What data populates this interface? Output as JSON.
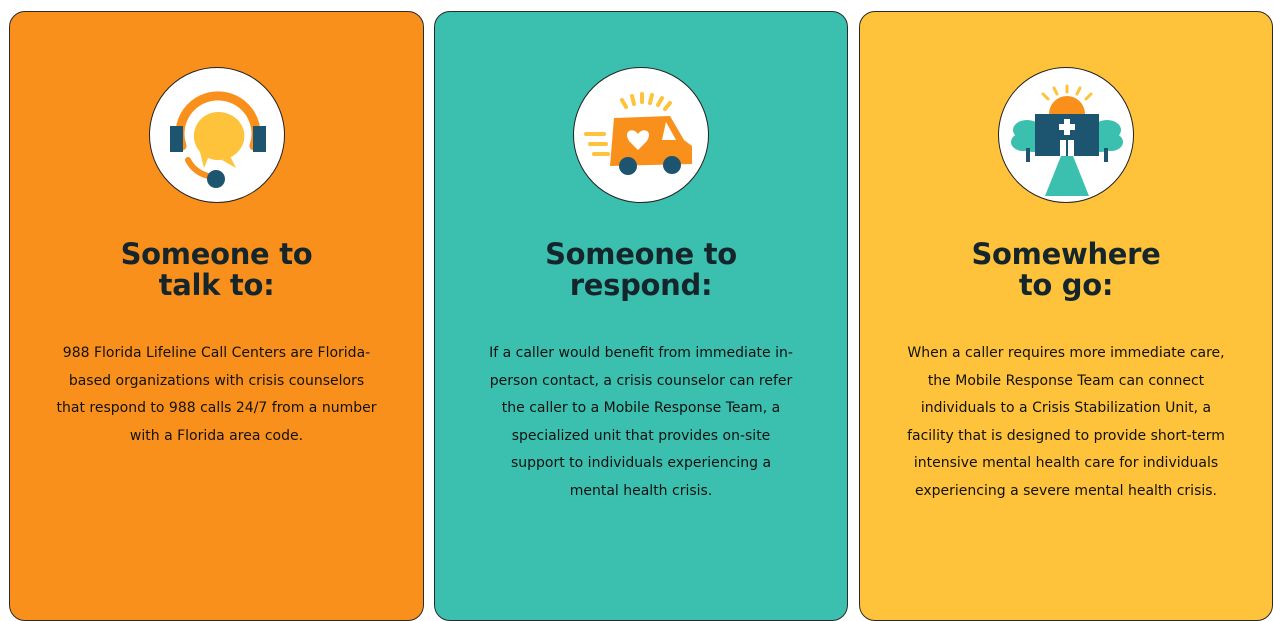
{
  "cards": [
    {
      "icon": "headset-chat-icon",
      "title_line1": "Someone to",
      "title_line2": "talk to:",
      "body": "988 Florida Lifeline Call Centers are Florida-based organizations with crisis counselors that respond to 988 calls 24/7 from a number with a Florida area code.",
      "background": "#fa901c"
    },
    {
      "icon": "response-vehicle-icon",
      "title_line1": "Someone to",
      "title_line2": "respond:",
      "body": "If a caller would benefit from immediate in-person contact, a crisis counselor can refer the caller to a Mobile Response Team, a specialized unit that provides on-site support to individuals experiencing a mental health crisis.",
      "background": "#3bbfae"
    },
    {
      "icon": "crisis-facility-icon",
      "title_line1": "Somewhere",
      "title_line2": "to go:",
      "body": "When a caller requires more immediate care, the Mobile Response Team can connect individuals to a Crisis Stabilization Unit, a facility that is designed to provide short-term intensive mental health care for individuals experiencing a severe mental health crisis.",
      "background": "#fec23b"
    }
  ],
  "colors": {
    "orange": "#fa901c",
    "teal": "#3bbfae",
    "yellow": "#fec23b",
    "navy": "#1d5570",
    "heading": "#14262b"
  }
}
